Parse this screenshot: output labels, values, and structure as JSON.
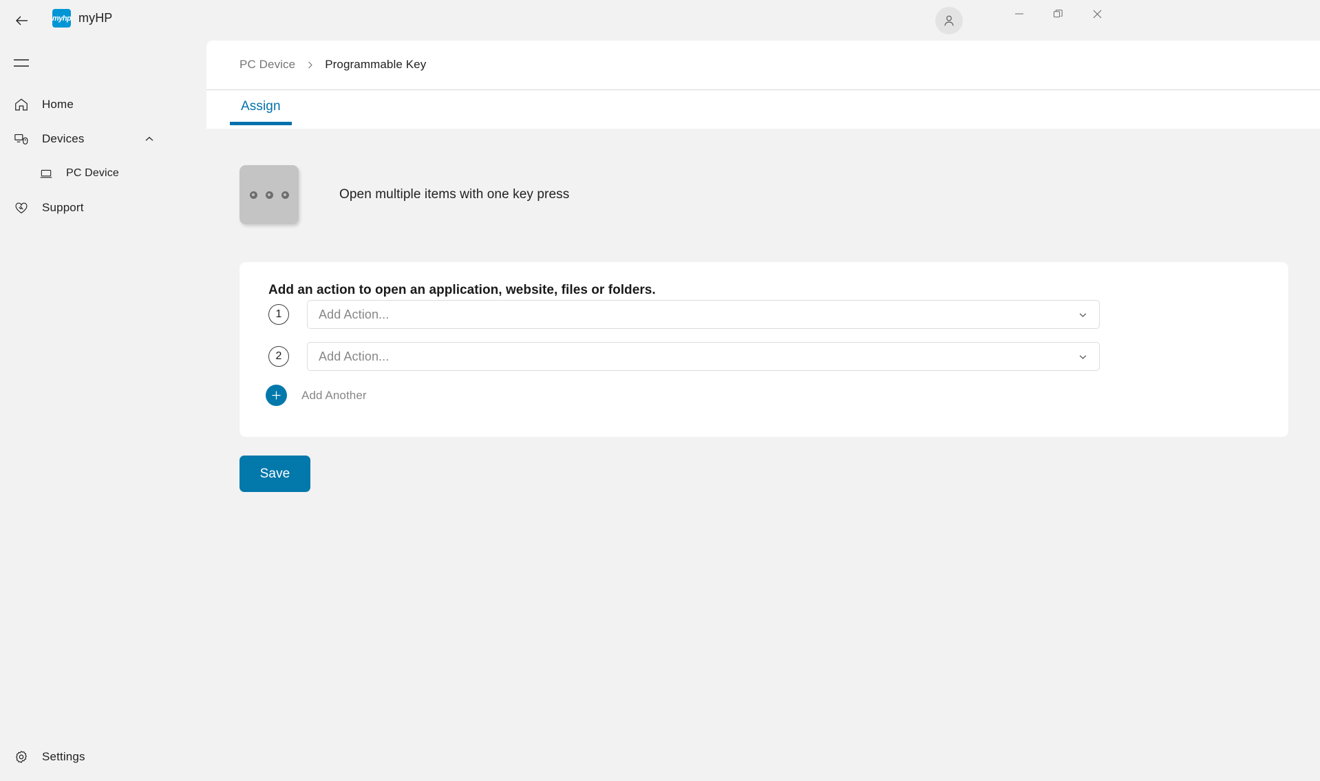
{
  "titlebar": {
    "back_icon": "arrow-left-icon",
    "logo_text": "myhp",
    "app_name": "myHP",
    "avatar_icon": "user-icon",
    "minimize_icon": "minimize-icon",
    "maximize_icon": "restore-icon",
    "close_icon": "close-icon"
  },
  "sidebar": {
    "menu_icon": "hamburger-icon",
    "items": [
      {
        "label": "Home",
        "icon": "home-icon"
      },
      {
        "label": "Devices",
        "icon": "devices-icon",
        "chevron": "chevron-up-icon"
      },
      {
        "label": "PC Device",
        "icon": "laptop-icon"
      },
      {
        "label": "Support",
        "icon": "support-handshake-icon"
      }
    ],
    "settings": {
      "label": "Settings",
      "icon": "gear-icon"
    }
  },
  "header": {
    "breadcrumb": {
      "parent": "PC Device",
      "separator": "chevron-right-icon",
      "current": "Programmable Key"
    },
    "tabs": [
      {
        "label": "Assign",
        "active": true
      }
    ]
  },
  "key_section": {
    "tile_icon": "three-dots-key-icon",
    "caption": "Open multiple items with one key press"
  },
  "card": {
    "title": "Add an action to open an application, website, files or folders.",
    "actions": [
      {
        "number": "1",
        "value": "Add Action...",
        "chevron": "chevron-down-icon"
      },
      {
        "number": "2",
        "value": "Add Action...",
        "chevron": "chevron-down-icon"
      }
    ],
    "add_another": {
      "label": "Add Another",
      "icon": "plus-icon"
    }
  },
  "footer": {
    "save_label": "Save"
  },
  "colors": {
    "accent": "#0278ab",
    "tab_blue": "#0171ad",
    "brand_blue": "#0096d6",
    "page_bg": "#f2f2f2",
    "panel_bg": "#ffffff",
    "key_tile": "#c4c4c4"
  }
}
